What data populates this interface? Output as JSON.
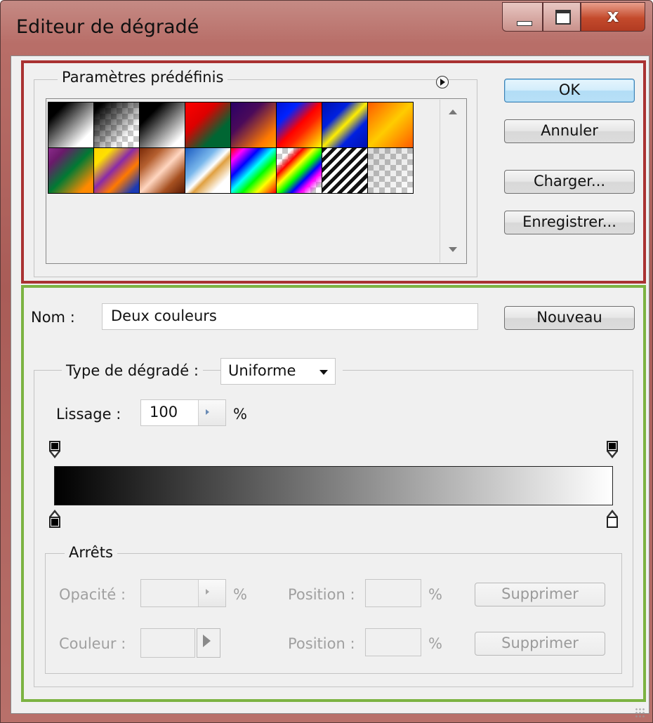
{
  "window": {
    "title": "Editeur de dégradé",
    "controls": {
      "minimize": "minimize",
      "maximize": "maximize",
      "close": "x"
    }
  },
  "presets": {
    "legend": "Paramètres prédéfinis",
    "menu_icon": "circle-arrow-right-icon",
    "swatches": [
      {
        "name": "foreground-to-background"
      },
      {
        "name": "foreground-to-transparent"
      },
      {
        "name": "black-white"
      },
      {
        "name": "red-green"
      },
      {
        "name": "violet-orange"
      },
      {
        "name": "blue-red-yellow"
      },
      {
        "name": "blue-yellow-blue"
      },
      {
        "name": "orange-yellow-orange"
      },
      {
        "name": "violet-green-orange"
      },
      {
        "name": "yellow-violet-orange-blue"
      },
      {
        "name": "copper"
      },
      {
        "name": "chrome"
      },
      {
        "name": "spectrum"
      },
      {
        "name": "transparent-rainbow"
      },
      {
        "name": "transparent-stripes"
      },
      {
        "name": "neutral-density"
      }
    ]
  },
  "buttons": {
    "ok": "OK",
    "cancel": "Annuler",
    "load": "Charger...",
    "save": "Enregistrer...",
    "new": "Nouveau",
    "delete_opacity": "Supprimer",
    "delete_color": "Supprimer"
  },
  "name_field": {
    "label": "Nom :",
    "value": "Deux couleurs"
  },
  "gradient_type": {
    "label": "Type de dégradé :",
    "selected": "Uniforme"
  },
  "smoothness": {
    "label": "Lissage :",
    "value": "100",
    "unit": "%"
  },
  "gradient": {
    "colors": {
      "start": "#000000",
      "end": "#ffffff"
    },
    "opacity_stops": [
      {
        "location": 0,
        "opacity": 100
      },
      {
        "location": 100,
        "opacity": 100
      }
    ],
    "color_stops": [
      {
        "location": 0,
        "color": "#000000"
      },
      {
        "location": 100,
        "color": "#ffffff"
      }
    ]
  },
  "stops": {
    "legend": "Arrêts",
    "opacity_label": "Opacité :",
    "opacity_unit": "%",
    "position_label_1": "Position :",
    "position_unit_1": "%",
    "color_label": "Couleur :",
    "position_label_2": "Position :",
    "position_unit_2": "%"
  },
  "colors": {
    "highlight_top": "#a93232",
    "highlight_bottom": "#7cb342"
  }
}
